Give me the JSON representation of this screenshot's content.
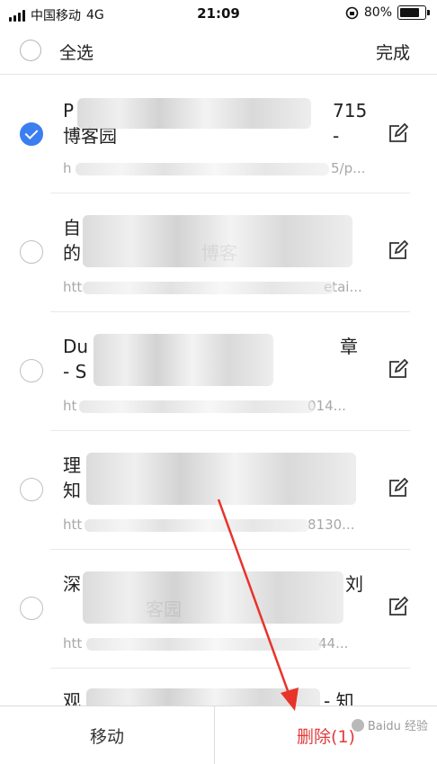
{
  "status_bar": {
    "carrier": "中国移动",
    "network": "4G",
    "time": "21:09",
    "battery": "80%",
    "battery_level": 0.8
  },
  "header": {
    "select_all": "全选",
    "done": "完成"
  },
  "items": [
    {
      "title_line1": "P",
      "title_end1": "715 -",
      "title_line2": "博客园",
      "url_start": "h",
      "url_end": "5/p...",
      "checked": true
    },
    {
      "title_line1": "自",
      "title_end1": "",
      "title_line2": "的",
      "title_end2": "博客",
      "url_start": "htt",
      "url_end": "etai...",
      "checked": false
    },
    {
      "title_line1": "Du",
      "title_end1": "章",
      "title_line2": "- S",
      "title_end2": "",
      "url_start": "ht",
      "url_end": "014...",
      "checked": false
    },
    {
      "title_line1": "理",
      "title_end1": "",
      "title_line2": "知",
      "title_end2": "",
      "url_start": "htt",
      "url_end": "8130...",
      "checked": false
    },
    {
      "title_line1": "深",
      "title_end1": "刘",
      "title_line2": "",
      "title_end2": "客园",
      "url_start": "htt",
      "url_end": "44...",
      "checked": false
    },
    {
      "title_line1": "观",
      "title_end1": "- 知",
      "title_line2": "",
      "title_end2": "",
      "url_start": "",
      "url_end": "",
      "checked": false
    }
  ],
  "bottom_bar": {
    "move": "移动",
    "delete": "删除(1)"
  },
  "watermark": {
    "text": "Baidu 经验"
  },
  "colors": {
    "accent": "#3b7ef0",
    "delete": "#e23b3b",
    "arrow": "#e8332a"
  }
}
